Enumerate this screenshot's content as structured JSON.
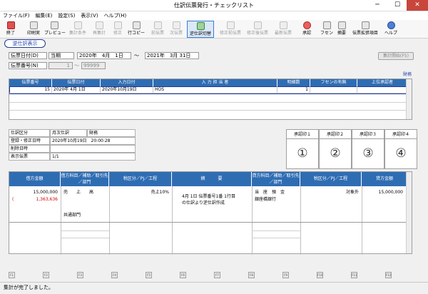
{
  "window": {
    "title": "仕訳伝票発行・チェックリスト",
    "minimize": "─",
    "maximize": "☐",
    "close": "✕"
  },
  "menu": [
    "ファイル(F)",
    "編集(E)",
    "設定(S)",
    "表示(V)",
    "ヘルプ(H)"
  ],
  "toolbar": {
    "items": [
      {
        "label": "終了",
        "icon": "close-icon"
      },
      {
        "label": "印刷実",
        "icon": "print-icon"
      },
      {
        "label": "プレビュー",
        "icon": "preview-icon"
      },
      {
        "label": "集計条件",
        "icon": "filter-icon"
      },
      {
        "label": "再集計",
        "icon": "recalc-icon"
      },
      {
        "label": "修正",
        "icon": "edit-icon"
      },
      {
        "label": "行コピー",
        "icon": "copy-icon"
      },
      {
        "label": "前伝票",
        "icon": "prev-icon"
      },
      {
        "label": "次伝票",
        "icon": "next-icon"
      },
      {
        "label": "逆仕訳切替",
        "icon": "switch-icon"
      },
      {
        "label": "修正前伝票",
        "icon": "doc-icon"
      },
      {
        "label": "修正後伝票",
        "icon": "doc-icon"
      },
      {
        "label": "最新伝票",
        "icon": "doc-icon"
      },
      {
        "label": "承認",
        "icon": "stamp-icon"
      },
      {
        "label": "フセン",
        "icon": "sticky-icon"
      },
      {
        "label": "摘要",
        "icon": "memo-icon"
      },
      {
        "label": "伝票拡張項目",
        "icon": "extend-icon"
      },
      {
        "label": "ヘルプ",
        "icon": "help-icon"
      }
    ]
  },
  "reverse_label": "逆仕訳表示",
  "filters": {
    "date_label": "伝票日付(D)",
    "period_type": "当期",
    "date_from": "2020年　4月　1日",
    "tilde": "～",
    "date_to": "2021年　3月 31日",
    "number_label": "伝票番号(N)",
    "number_from": "1",
    "number_to": "99999",
    "aggregate_button": "集計開始(F5)",
    "zaimu": "財務"
  },
  "grid": {
    "headers": [
      "伝票番号",
      "伝票日付",
      "入力日付",
      "入 力 担 当 者",
      "明細数",
      "フセンの有無",
      "上位承認者"
    ],
    "rows": [
      [
        "15",
        "2020年 4月 1日",
        "2020年10月19日",
        "HOS",
        "1",
        "",
        ""
      ]
    ]
  },
  "details": {
    "labels": [
      "仕訳区分",
      "登録・修正日時",
      "削除日時",
      "表示伝票"
    ],
    "kubun": "月次仕訳",
    "kubun2": "財務",
    "updated": "2020年10月19日　20:00:28",
    "deleted": "",
    "shown": "1/1"
  },
  "approvals": [
    {
      "label": "承認印１",
      "mark": "①"
    },
    {
      "label": "承認印２",
      "mark": "②"
    },
    {
      "label": "承認印３",
      "mark": "③"
    },
    {
      "label": "承認印４",
      "mark": "④"
    }
  ],
  "journal": {
    "headers": {
      "debit_amount": "借方金額",
      "debit_account": "借方科目／補助／取引先／部門",
      "debit_tax": "税区分／PJ／工程",
      "summary": "摘　　　要",
      "credit_account": "貸方科目／補助／取引先／部門",
      "credit_tax": "税区分／PJ／工程",
      "credit_amount": "貸方金額"
    },
    "debit_amount": "15,000,000",
    "tax_open": "(",
    "tax_amount": "1,363,636",
    "debit_account": "売　　上　　高",
    "debit_tax": "売上10%",
    "dept": "共通部門",
    "summary_line1": "4月 1日 伝票番号1番 1行目",
    "summary_line2": "の仕訳より逆仕訳作成",
    "credit_account": "当　座　預　金",
    "credit_sub": "銀座橋銀行",
    "credit_tax": "対象外",
    "credit_amount": "15,000,000"
  },
  "fkeys": [
    "F1",
    "F2",
    "F3",
    "F4",
    "F5",
    "F6",
    "F7",
    "F8",
    "F9",
    "F10",
    "F11",
    "F12"
  ],
  "status": "集計が完了しました。",
  "colors": {
    "accent": "#2f6db3",
    "red": "#d00000",
    "close": "#c8463c"
  }
}
